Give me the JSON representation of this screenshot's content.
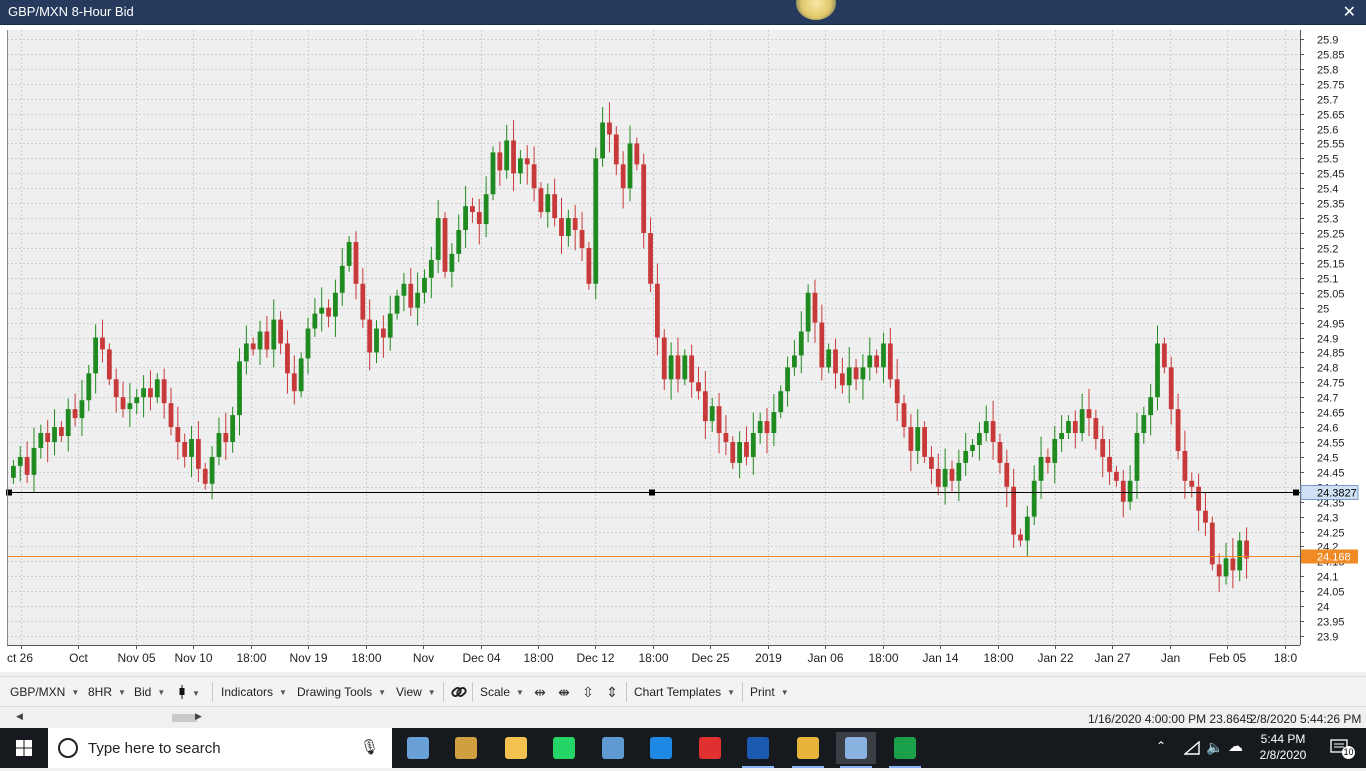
{
  "window": {
    "title": "GBP/MXN 8-Hour Bid",
    "close_glyph": "✕"
  },
  "chart_data": {
    "type": "candlestick",
    "symbol": "GBP/MXN",
    "interval": "8HR",
    "side": "Bid",
    "ylim": [
      23.87,
      25.93
    ],
    "y_ticks": [
      "25.9",
      "25.85",
      "25.8",
      "25.75",
      "25.7",
      "25.65",
      "25.6",
      "25.55",
      "25.5",
      "25.45",
      "25.4",
      "25.35",
      "25.3",
      "25.25",
      "25.2",
      "25.15",
      "25.1",
      "25.05",
      "25",
      "24.95",
      "24.9",
      "24.85",
      "24.8",
      "24.75",
      "24.7",
      "24.65",
      "24.6",
      "24.55",
      "24.5",
      "24.45",
      "24.4",
      "24.35",
      "24.3",
      "24.25",
      "24.2",
      "24.15",
      "24.1",
      "24.05",
      "24",
      "23.95",
      "23.9"
    ],
    "x_labels": [
      "ct 26",
      "Oct",
      "Nov 05",
      "Nov 10",
      "18:00",
      "Nov 19",
      "18:00",
      "Nov",
      "Dec 04",
      "18:00",
      "Dec 12",
      "18:00",
      "Dec 25",
      "2019",
      "Jan 06",
      "18:00",
      "Jan 14",
      "18:00",
      "Jan 22",
      "Jan 27",
      "Jan",
      "Feb 05",
      "18:0"
    ],
    "colors": {
      "up": "#1f8a1f",
      "down": "#c83a3a",
      "grid": "#cfcfcf",
      "hline": "#000000",
      "price_line": "#ee8a2a",
      "price_badge": "#f08a24",
      "hline_badge": "#cfe0f4"
    },
    "horizontal_line": {
      "value": 24.3827,
      "label": "24.3827"
    },
    "last_price": {
      "value": 24.168,
      "label": "24.168"
    },
    "closes": [
      24.47,
      24.5,
      24.44,
      24.53,
      24.58,
      24.55,
      24.6,
      24.57,
      24.66,
      24.63,
      24.69,
      24.78,
      24.9,
      24.86,
      24.76,
      24.7,
      24.66,
      24.68,
      24.7,
      24.73,
      24.7,
      24.76,
      24.68,
      24.6,
      24.55,
      24.5,
      24.56,
      24.46,
      24.41,
      24.5,
      24.58,
      24.55,
      24.64,
      24.82,
      24.88,
      24.86,
      24.92,
      24.86,
      24.96,
      24.88,
      24.78,
      24.72,
      24.83,
      24.93,
      24.98,
      25.0,
      24.97,
      25.05,
      25.14,
      25.22,
      25.08,
      24.96,
      24.85,
      24.93,
      24.9,
      24.98,
      25.04,
      25.08,
      25.0,
      25.05,
      25.1,
      25.16,
      25.3,
      25.12,
      25.18,
      25.26,
      25.34,
      25.32,
      25.28,
      25.38,
      25.52,
      25.46,
      25.56,
      25.45,
      25.5,
      25.48,
      25.4,
      25.32,
      25.38,
      25.3,
      25.24,
      25.3,
      25.26,
      25.2,
      25.08,
      25.5,
      25.62,
      25.58,
      25.48,
      25.4,
      25.55,
      25.48,
      25.25,
      25.08,
      24.9,
      24.76,
      24.84,
      24.76,
      24.84,
      24.75,
      24.72,
      24.62,
      24.67,
      24.58,
      24.55,
      24.48,
      24.55,
      24.5,
      24.58,
      24.62,
      24.58,
      24.65,
      24.72,
      24.8,
      24.84,
      24.92,
      25.05,
      24.95,
      24.8,
      24.86,
      24.78,
      24.74,
      24.8,
      24.76,
      24.8,
      24.84,
      24.8,
      24.88,
      24.76,
      24.68,
      24.6,
      24.52,
      24.6,
      24.5,
      24.46,
      24.4,
      24.46,
      24.42,
      24.48,
      24.52,
      24.54,
      24.58,
      24.62,
      24.55,
      24.48,
      24.4,
      24.24,
      24.22,
      24.3,
      24.42,
      24.5,
      24.48,
      24.56,
      24.58,
      24.62,
      24.58,
      24.66,
      24.63,
      24.56,
      24.5,
      24.45,
      24.42,
      24.35,
      24.42,
      24.58,
      24.64,
      24.7,
      24.88,
      24.8,
      24.66,
      24.52,
      24.42,
      24.4,
      24.32,
      24.28,
      24.14,
      24.1,
      24.16,
      24.12,
      24.22,
      24.16
    ]
  },
  "toolbar": {
    "symbol": "GBP/MXN",
    "interval": "8HR",
    "side": "Bid",
    "indicators": "Indicators",
    "drawing_tools": "Drawing Tools",
    "view": "View",
    "scale": "Scale",
    "chart_templates": "Chart Templates",
    "print": "Print"
  },
  "status": {
    "cursor_readout": "1/16/2020 4:00:00 PM 23.8645",
    "current_time": "2/8/2020 5:44:26 PM"
  },
  "taskbar": {
    "search_placeholder": "Type here to search",
    "time": "5:44 PM",
    "date": "2/8/2020",
    "notification_count": "10",
    "apps": [
      {
        "name": "app-1",
        "color": "#6aa0d8"
      },
      {
        "name": "app-2",
        "color": "#d0a040"
      },
      {
        "name": "file-explorer",
        "color": "#f2c14e"
      },
      {
        "name": "whatsapp",
        "color": "#25d366"
      },
      {
        "name": "app-5",
        "color": "#5f9ad3"
      },
      {
        "name": "internet-explorer",
        "color": "#1e88e5"
      },
      {
        "name": "app-7",
        "color": "#e03030"
      },
      {
        "name": "fxchoice",
        "color": "#1a5bb0"
      },
      {
        "name": "chrome",
        "color": "#e8b33a"
      },
      {
        "name": "app-10",
        "color": "#8ab2e0"
      },
      {
        "name": "app-11",
        "color": "#1aa04a"
      }
    ]
  }
}
